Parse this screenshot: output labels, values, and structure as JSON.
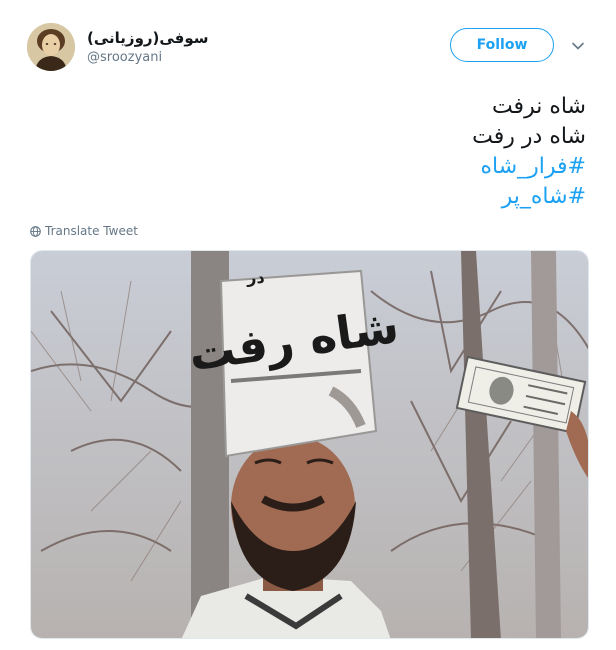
{
  "author": {
    "display_name": "(سوفی(روزیانی",
    "handle": "@sroozyani"
  },
  "actions": {
    "follow_label": "Follow",
    "translate_label": "Translate Tweet"
  },
  "tweet": {
    "lines": [
      "شاه نرفت",
      "شاه در رفت"
    ],
    "hashtags": [
      "#فرار_شاه",
      "#شاه_پر"
    ]
  },
  "media": {
    "hat_text": "شاه رفت",
    "hat_text_small": "در"
  },
  "colors": {
    "accent": "#1da1f2",
    "secondary_text": "#657786",
    "primary_text": "#14171a"
  },
  "icons": {
    "more": "chevron-down-icon",
    "translate": "globe-icon"
  }
}
